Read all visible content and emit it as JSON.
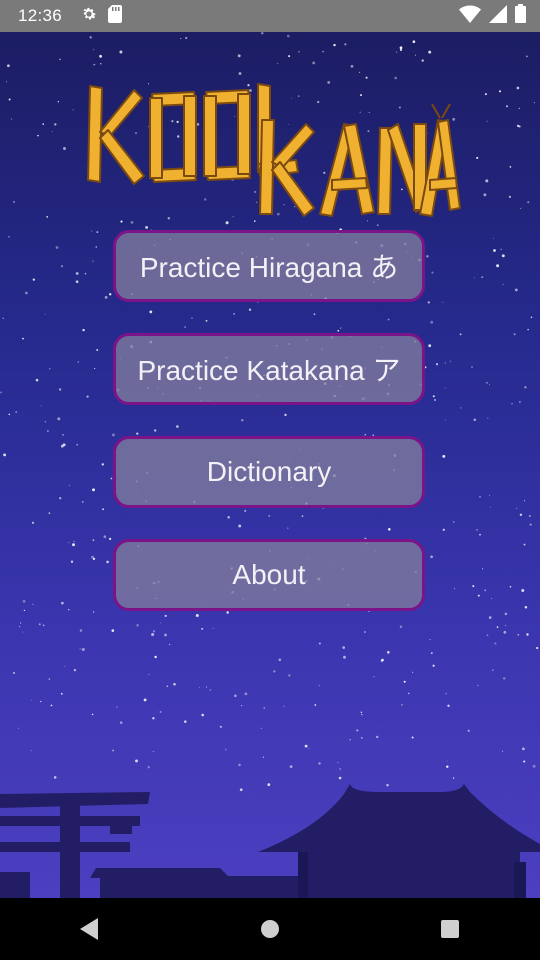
{
  "status_bar": {
    "time": "12:36",
    "left_icons": [
      "gear-icon",
      "sd-card-icon"
    ],
    "right_icons": [
      "wifi-icon",
      "signal-icon",
      "battery-icon"
    ]
  },
  "app": {
    "logo_text": "KOOL KANA",
    "colors": {
      "sky_top": "#1c1d63",
      "sky_bottom": "#4c3fc0",
      "button_fill": "#807c9e",
      "button_border": "#7b1488",
      "logo": "#f0b030"
    },
    "buttons": [
      {
        "label": "Practice Hiragana あ"
      },
      {
        "label": "Practice Katakana ア"
      },
      {
        "label": "Dictionary"
      },
      {
        "label": "About"
      }
    ]
  },
  "nav_bar": {
    "icons": [
      "back-icon",
      "home-icon",
      "recents-icon"
    ]
  }
}
